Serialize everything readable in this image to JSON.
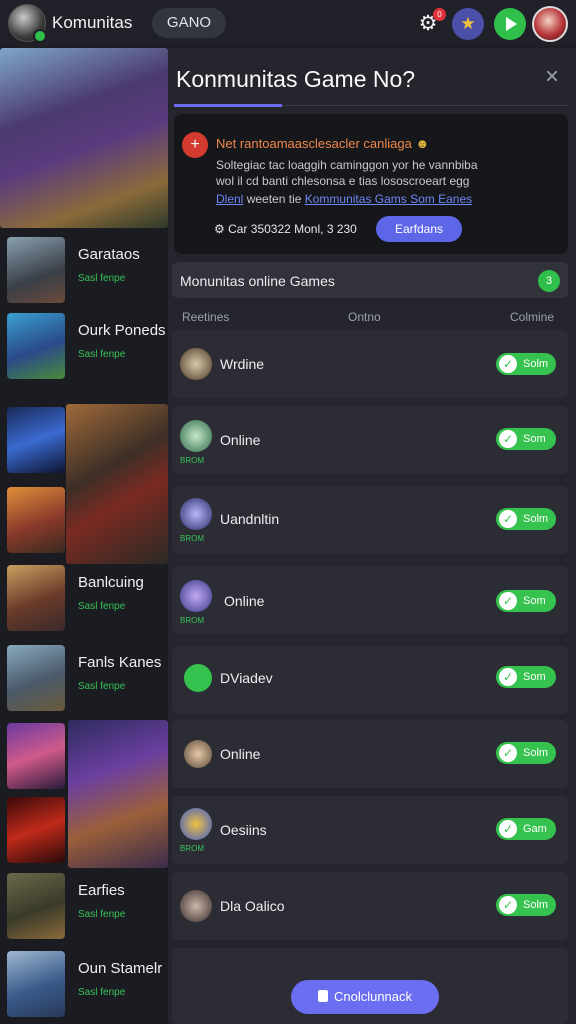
{
  "header": {
    "app_title": "Komunitas",
    "tab_label": "GANO",
    "gear_badge": "0"
  },
  "game_list": [
    {
      "name": "Garataos",
      "sub": "Sasl fenpe"
    },
    {
      "name": "Ourk Poneds",
      "sub": "Sasl fenpe"
    },
    {
      "name": "Banlcuing",
      "sub": "Sasl fenpe"
    },
    {
      "name": "Fanls Kanes",
      "sub": "Sasl fenpe"
    },
    {
      "name": "Earfies",
      "sub": "Sasl fenpe"
    },
    {
      "name": "Oun Stamelr",
      "sub": "Sasl fenpe"
    }
  ],
  "panel": {
    "title": "Konmunitas Game No?",
    "close": "×",
    "notice": {
      "heading": "Net rantoamaasclesacler canliaga",
      "line1": "Soltegiac tac loaggih caminggon yor he vannbiba",
      "line2": "wol il cd banti chlesonsa e tias lososcroeart egg",
      "link_prefix": "Dlenl",
      "link_mid": "weeten tie",
      "link_text": "Kommunitas Gams Som Eanes",
      "meta": "Car 350322 Monl, 3 230",
      "button": "Earfdans"
    },
    "section_title": "Monunitas online Games",
    "section_count": "3",
    "columns": [
      "Reetines",
      "Ontno",
      "Colmine"
    ],
    "rows": [
      {
        "name": "Wrdine",
        "sub": "",
        "toggle": "Solm"
      },
      {
        "name": "Online",
        "sub": "BROM",
        "toggle": "Som"
      },
      {
        "name": "Uandnltin",
        "sub": "BROM",
        "toggle": "Solm"
      },
      {
        "name": "Online",
        "sub": "BROM",
        "toggle": "Som"
      },
      {
        "name": "DViadev",
        "sub": "",
        "toggle": "Som"
      },
      {
        "name": "Online",
        "sub": "",
        "toggle": "Solm"
      },
      {
        "name": "Oesiins",
        "sub": "BROM",
        "toggle": "Gam"
      },
      {
        "name": "Dla Oalico",
        "sub": "",
        "toggle": "Solm"
      }
    ],
    "bottom_button": "Cnolclunnack"
  },
  "colors": {
    "accent": "#6b6ef0",
    "online_green": "#36c24e",
    "alert_red": "#d53a2f",
    "background": "#1d1e24"
  },
  "icons": [
    "gear-icon",
    "star-icon",
    "play-icon",
    "close-icon",
    "alert-icon",
    "check-icon"
  ]
}
